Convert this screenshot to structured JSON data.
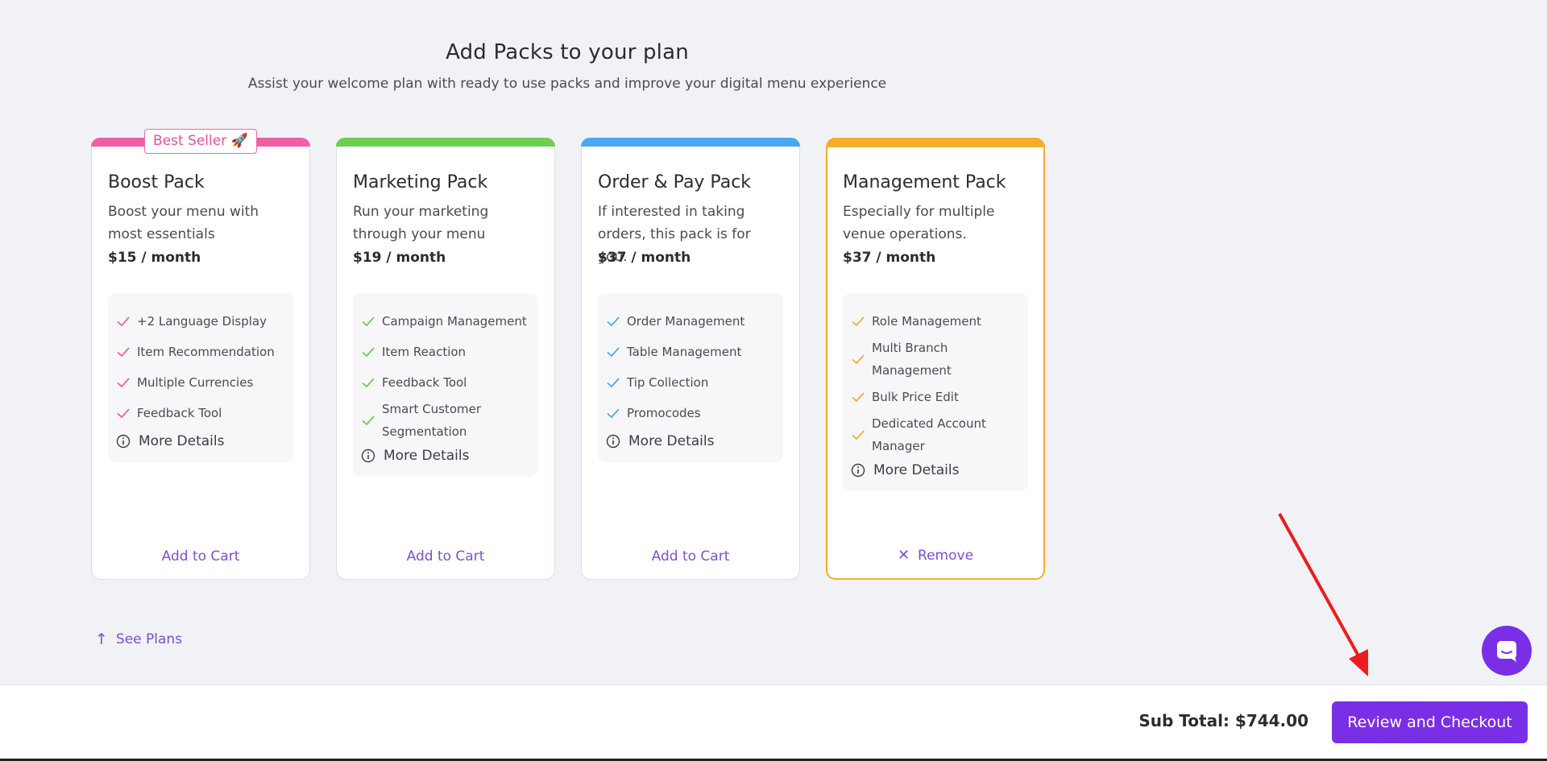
{
  "header": {
    "title": "Add Packs to your plan",
    "subtitle": "Assist your welcome plan with ready to use packs and improve your digital menu experience"
  },
  "cards": [
    {
      "accent": "#f05fa6",
      "badge": "Best Seller 🚀",
      "title": "Boost Pack",
      "description": "Boost your menu with most essentials",
      "price": "$15 / month",
      "features": [
        "+2 Language Display",
        "Item Recommendation",
        "Multiple Currencies",
        "Feedback Tool"
      ],
      "more_label": "More Details",
      "action_label": "Add to Cart",
      "selected": false
    },
    {
      "accent": "#6dce4f",
      "badge": "",
      "title": "Marketing Pack",
      "description": "Run your marketing through your menu",
      "price": "$19 / month",
      "features": [
        "Campaign Management",
        "Item Reaction",
        "Feedback Tool",
        "Smart Customer Segmentation"
      ],
      "more_label": "More Details",
      "action_label": "Add to Cart",
      "selected": false
    },
    {
      "accent": "#4aa8f2",
      "badge": "",
      "title": "Order & Pay Pack",
      "description": "If interested in taking orders, this pack is for you.",
      "price": "$37 / month",
      "features": [
        "Order Management",
        "Table Management",
        "Tip Collection",
        "Promocodes"
      ],
      "more_label": "More Details",
      "action_label": "Add to Cart",
      "selected": false
    },
    {
      "accent": "#f5ad2e",
      "badge": "",
      "title": "Management Pack",
      "description": "Especially for multiple venue operations.",
      "price": "$37 / month",
      "features": [
        "Role Management",
        "Multi Branch Management",
        "Bulk Price Edit",
        "Dedicated Account Manager"
      ],
      "more_label": "More Details",
      "action_label": "Remove",
      "selected": true
    }
  ],
  "see_plans": {
    "label": "See Plans"
  },
  "footer": {
    "subtotal": "Sub Total: $744.00",
    "checkout_label": "Review and Checkout"
  },
  "icons": {
    "check": "check-icon",
    "info": "info-icon",
    "remove": "close-icon",
    "up_arrow": "arrow-up-icon",
    "chat": "chat-icon"
  },
  "colors": {
    "primary": "#7a2fe6",
    "link": "#7a4fd8",
    "annotation": "#ee1c1c"
  }
}
